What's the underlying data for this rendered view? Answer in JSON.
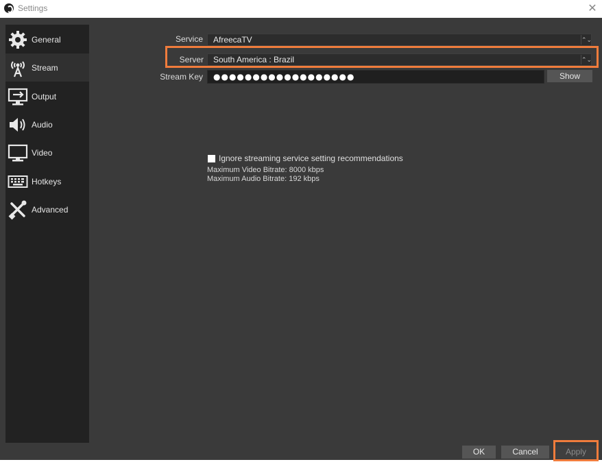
{
  "window": {
    "title": "Settings"
  },
  "sidebar": {
    "items": [
      {
        "label": "General",
        "icon": "gear-icon",
        "active": false
      },
      {
        "label": "Stream",
        "icon": "broadcast-icon",
        "active": true
      },
      {
        "label": "Output",
        "icon": "output-monitor-icon",
        "active": false
      },
      {
        "label": "Audio",
        "icon": "speaker-icon",
        "active": false
      },
      {
        "label": "Video",
        "icon": "monitor-icon",
        "active": false
      },
      {
        "label": "Hotkeys",
        "icon": "keyboard-icon",
        "active": false
      },
      {
        "label": "Advanced",
        "icon": "tools-icon",
        "active": false
      }
    ]
  },
  "stream": {
    "service_label": "Service",
    "service_value": "AfreecaTV",
    "server_label": "Server",
    "server_value": "South America : Brazil",
    "stream_key_label": "Stream Key",
    "stream_key_value": "●●●●●●●●●●●●●●●●●●",
    "show_button": "Show",
    "ignore_checkbox_label": "Ignore streaming service setting recommendations",
    "ignore_checked": false,
    "max_video_bitrate": "Maximum Video Bitrate: 8000 kbps",
    "max_audio_bitrate": "Maximum Audio Bitrate: 192 kbps"
  },
  "footer": {
    "ok": "OK",
    "cancel": "Cancel",
    "apply": "Apply"
  },
  "colors": {
    "highlight": "#f07c3c",
    "background": "#3a3a3a",
    "sidebar": "#222222"
  }
}
